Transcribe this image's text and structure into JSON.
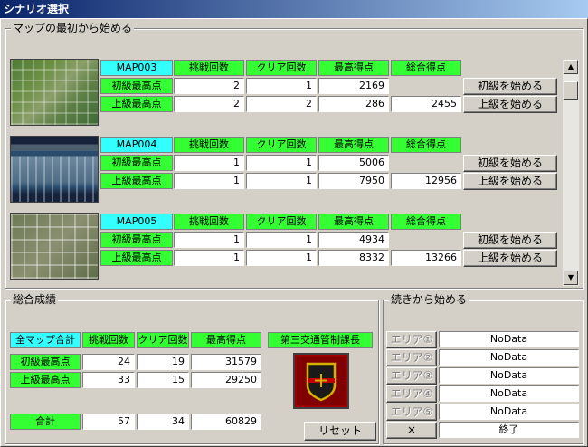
{
  "window": {
    "title": "シナリオ選択"
  },
  "top_group": {
    "title": "マップの最初から始める"
  },
  "headers": {
    "attempts": "挑戦回数",
    "clears": "クリア回数",
    "high_score": "最高得点",
    "total_score": "総合得点"
  },
  "row_labels": {
    "beginner": "初級最高点",
    "advanced": "上級最高点"
  },
  "buttons": {
    "start_beginner": "初級を始める",
    "start_advanced": "上級を始める",
    "reset": "リセット"
  },
  "scrollbar": {
    "up_icon": "▲",
    "down_icon": "▼"
  },
  "maps": [
    {
      "name": "MAP003",
      "beginner": {
        "attempts": "2",
        "clears": "1",
        "high": "2169"
      },
      "advanced": {
        "attempts": "2",
        "clears": "2",
        "high": "286"
      },
      "total": "2455"
    },
    {
      "name": "MAP004",
      "beginner": {
        "attempts": "1",
        "clears": "1",
        "high": "5006"
      },
      "advanced": {
        "attempts": "1",
        "clears": "1",
        "high": "7950"
      },
      "total": "12956"
    },
    {
      "name": "MAP005",
      "beginner": {
        "attempts": "1",
        "clears": "1",
        "high": "4934"
      },
      "advanced": {
        "attempts": "1",
        "clears": "1",
        "high": "8332"
      },
      "total": "13266"
    }
  ],
  "overall": {
    "title": "総合成績",
    "all_maps_label": "全マップ合計",
    "rank": "第三交通管制課長",
    "beginner": {
      "attempts": "24",
      "clears": "19",
      "high": "31579"
    },
    "advanced": {
      "attempts": "33",
      "clears": "15",
      "high": "29250"
    },
    "total_label": "合計",
    "total": {
      "attempts": "57",
      "clears": "34",
      "high": "60829"
    }
  },
  "continue": {
    "title": "続きから始める",
    "areas": [
      {
        "label": "エリア①",
        "value": "NoData"
      },
      {
        "label": "エリア②",
        "value": "NoData"
      },
      {
        "label": "エリア③",
        "value": "NoData"
      },
      {
        "label": "エリア④",
        "value": "NoData"
      },
      {
        "label": "エリア⑤",
        "value": "NoData"
      }
    ],
    "close_label": "×",
    "exit_label": "終了"
  },
  "colors": {
    "header_cyan": "#33ffff",
    "header_green": "#33ff33",
    "badge_red": "#800000",
    "badge_gold": "#d4b000"
  }
}
